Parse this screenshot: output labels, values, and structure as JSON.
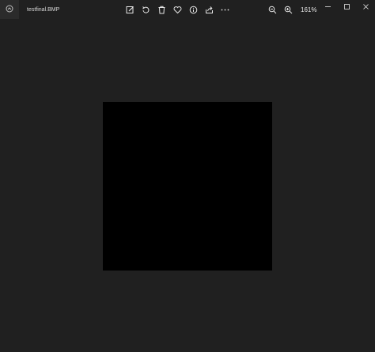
{
  "window": {
    "title": "testfinal.BMP"
  },
  "toolbar": {
    "icons": [
      "edit-image-icon",
      "rotate-icon",
      "delete-icon",
      "favorite-icon",
      "info-icon",
      "share-icon",
      "more-icon"
    ]
  },
  "zoom": {
    "level": "161%"
  },
  "colors": {
    "background": "#202020",
    "image": "#000000",
    "icon": "#e6e6e6"
  }
}
